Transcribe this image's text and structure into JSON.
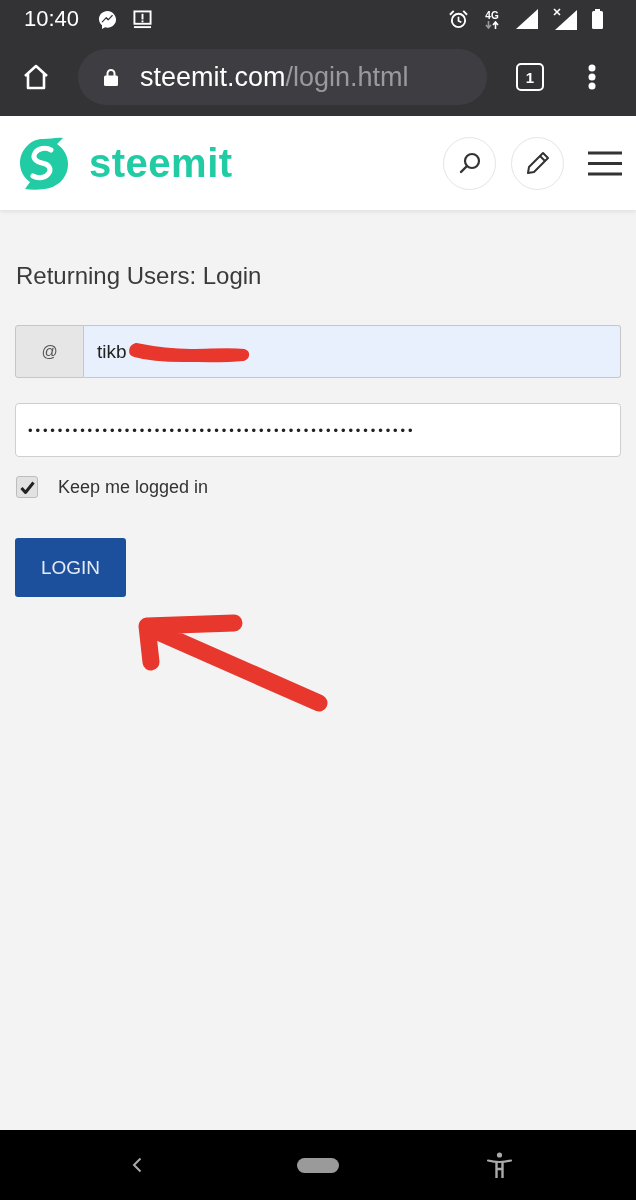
{
  "status_bar": {
    "time": "10:40",
    "network_type": "4G"
  },
  "browser_toolbar": {
    "url_host": "steemit.com",
    "url_path": "/login.html",
    "tab_count": "1"
  },
  "site_header": {
    "logo_text": "steemit"
  },
  "login_form": {
    "title": "Returning Users: Login",
    "username": {
      "prefix": "@",
      "value": "tikb"
    },
    "password": {
      "value": "••••••••••••••••••••••••••••••••••••••••••••••••••••"
    },
    "keep_logged_in": {
      "label": "Keep me logged in",
      "checked": true
    },
    "submit_button": {
      "label": "LOGIN"
    }
  }
}
